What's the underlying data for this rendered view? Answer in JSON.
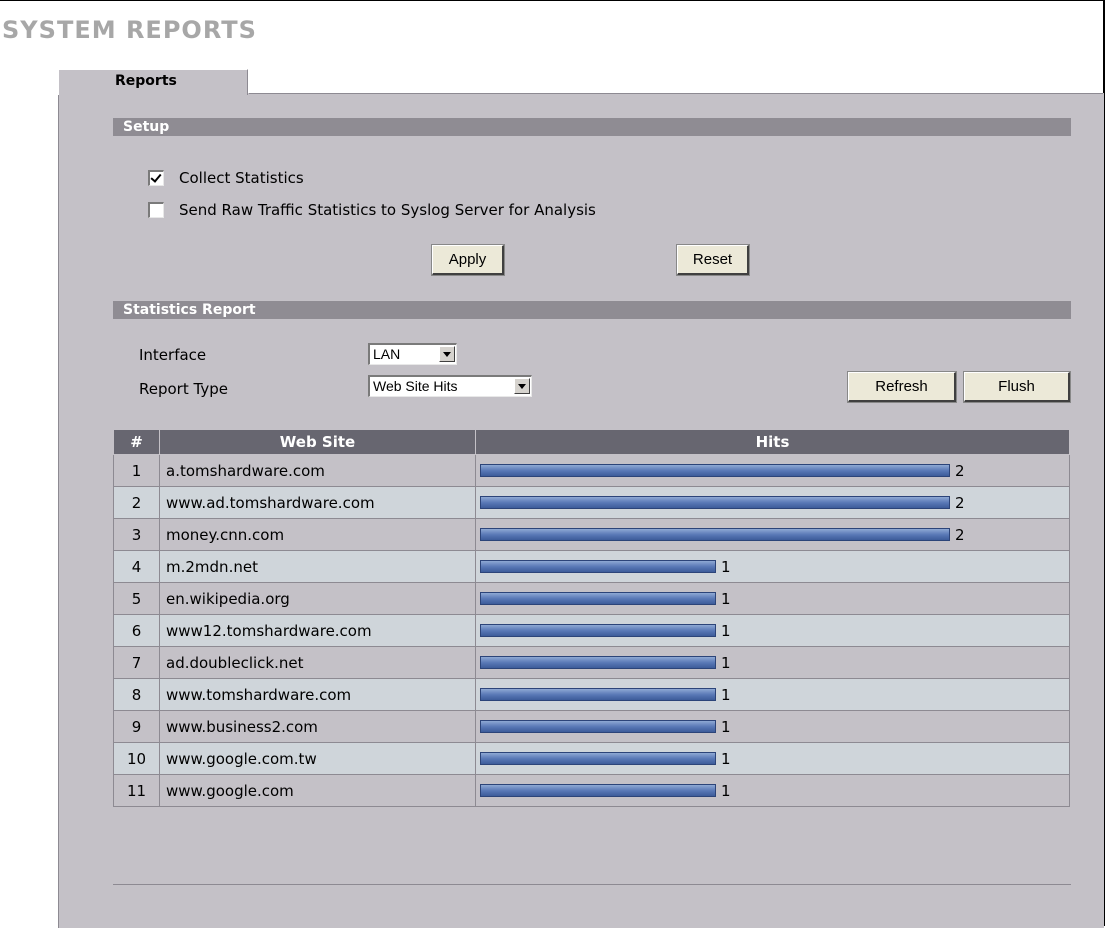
{
  "page": {
    "title": "SYSTEM REPORTS"
  },
  "tabs": [
    {
      "label": "Reports"
    }
  ],
  "setup": {
    "header": "Setup",
    "collect_statistics": {
      "label": "Collect Statistics",
      "checked": true
    },
    "send_raw": {
      "label": "Send Raw Traffic Statistics to Syslog Server for Analysis",
      "checked": false
    },
    "apply_label": "Apply",
    "reset_label": "Reset"
  },
  "report": {
    "header": "Statistics Report",
    "interface_label": "Interface",
    "interface_value": "LAN",
    "report_type_label": "Report Type",
    "report_type_value": "Web Site Hits",
    "refresh_label": "Refresh",
    "flush_label": "Flush"
  },
  "table": {
    "columns": [
      "#",
      "Web Site",
      "Hits"
    ],
    "max_hits": 2,
    "rows": [
      {
        "num": "1",
        "site": "a.tomshardware.com",
        "hits": 2
      },
      {
        "num": "2",
        "site": "www.ad.tomshardware.com",
        "hits": 2
      },
      {
        "num": "3",
        "site": "money.cnn.com",
        "hits": 2
      },
      {
        "num": "4",
        "site": "m.2mdn.net",
        "hits": 1
      },
      {
        "num": "5",
        "site": "en.wikipedia.org",
        "hits": 1
      },
      {
        "num": "6",
        "site": "www12.tomshardware.com",
        "hits": 1
      },
      {
        "num": "7",
        "site": "ad.doubleclick.net",
        "hits": 1
      },
      {
        "num": "8",
        "site": "www.tomshardware.com",
        "hits": 1
      },
      {
        "num": "9",
        "site": "www.business2.com",
        "hits": 1
      },
      {
        "num": "10",
        "site": "www.google.com.tw",
        "hits": 1
      },
      {
        "num": "11",
        "site": "www.google.com",
        "hits": 1
      }
    ]
  },
  "colors": {
    "panel": "#c4c1c7",
    "section_bar": "#8f8c93",
    "table_header": "#676670",
    "row_alt": "#cfd5da",
    "bar": "#5a79b7"
  }
}
